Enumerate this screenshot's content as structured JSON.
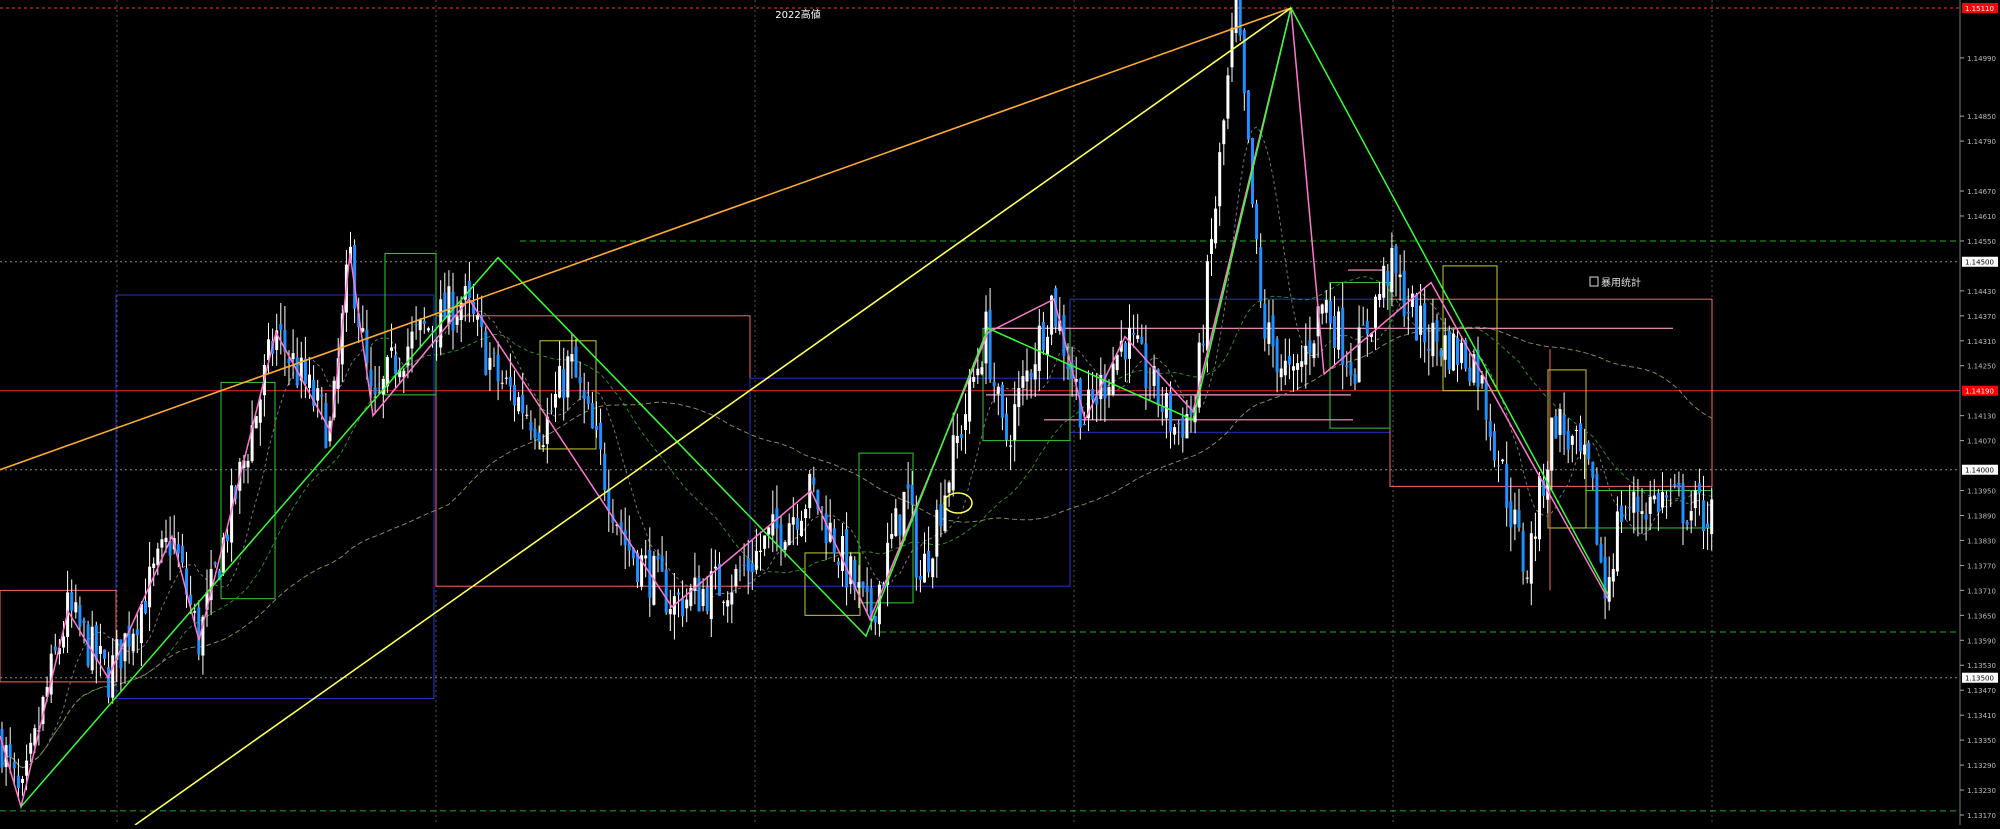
{
  "chart_data": {
    "type": "candlestick",
    "annotations": {
      "high_label": "2022高値",
      "stats_label": "暴用统計"
    },
    "y_axis": {
      "range": [
        1.3511,
        1.1525
      ],
      "ticks": [
        {
          "value": 1.1499,
          "label": "1.14990"
        },
        {
          "value": 1.1485,
          "label": "1.14850"
        },
        {
          "value": 1.1479,
          "label": "1.14790"
        },
        {
          "value": 1.1467,
          "label": "1.14670"
        },
        {
          "value": 1.1461,
          "label": "1.14610"
        },
        {
          "value": 1.1455,
          "label": "1.14550"
        },
        {
          "value": 1.1443,
          "label": "1.14430"
        },
        {
          "value": 1.1437,
          "label": "1.14370"
        },
        {
          "value": 1.1431,
          "label": "1.14310"
        },
        {
          "value": 1.1425,
          "label": "1.14250"
        },
        {
          "value": 1.1413,
          "label": "1.14130"
        },
        {
          "value": 1.1407,
          "label": "1.14070"
        },
        {
          "value": 1.1395,
          "label": "1.13950"
        },
        {
          "value": 1.1389,
          "label": "1.13890"
        },
        {
          "value": 1.1383,
          "label": "1.13830"
        },
        {
          "value": 1.1377,
          "label": "1.13770"
        },
        {
          "value": 1.1371,
          "label": "1.13710"
        },
        {
          "value": 1.1365,
          "label": "1.13650"
        },
        {
          "value": 1.1359,
          "label": "1.13590"
        },
        {
          "value": 1.1353,
          "label": "1.13530"
        },
        {
          "value": 1.1347,
          "label": "1.13470"
        },
        {
          "value": 1.1341,
          "label": "1.13410"
        },
        {
          "value": 1.1335,
          "label": "1.13350"
        },
        {
          "value": 1.1329,
          "label": "1.13290"
        },
        {
          "value": 1.1323,
          "label": "1.13230"
        },
        {
          "value": 1.1317,
          "label": "1.13170"
        }
      ],
      "price_tags": [
        {
          "value": 1.1511,
          "label": "1.15110",
          "bg": "#ff0000",
          "fg": "#ffffff"
        },
        {
          "value": 1.145,
          "label": "1.14500",
          "bg": "#ffffff",
          "fg": "#000000"
        },
        {
          "value": 1.1419,
          "label": "1.14190",
          "bg": "#ff0000",
          "fg": "#ffffff"
        },
        {
          "value": 1.14,
          "label": "1.14000",
          "bg": "#ffffff",
          "fg": "#000000"
        },
        {
          "value": 1.135,
          "label": "1.13500",
          "bg": "#ffffff",
          "fg": "#000000"
        }
      ]
    },
    "candles": [],
    "colors": {
      "bull_body": "#ffffff",
      "bear_body": "#1e90ff",
      "wick": "#ffffff",
      "grid": "#555555",
      "zigzag_pink": "#ff77cc",
      "zigzag_green": "#33ff33",
      "trend_orange": "#ffaa33",
      "trend_yellow": "#ffff55",
      "box_red": "#ff6666",
      "box_green": "#33cc33",
      "box_blue": "#2233cc",
      "box_yellow": "#cccc33"
    }
  }
}
